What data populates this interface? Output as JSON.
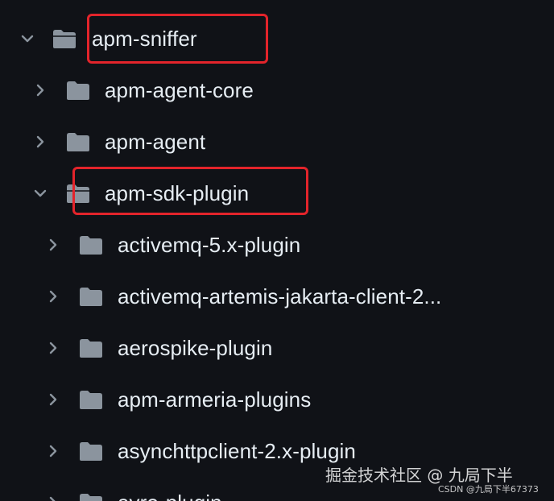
{
  "tree": {
    "items": [
      {
        "label": "apm-sniffer",
        "state": "expanded",
        "depth": 0,
        "highlighted": true
      },
      {
        "label": "apm-agent-core",
        "state": "collapsed",
        "depth": 1,
        "highlighted": false
      },
      {
        "label": "apm-agent",
        "state": "collapsed",
        "depth": 1,
        "highlighted": false
      },
      {
        "label": "apm-sdk-plugin",
        "state": "expanded",
        "depth": 1,
        "highlighted": true
      },
      {
        "label": "activemq-5.x-plugin",
        "state": "collapsed",
        "depth": 2,
        "highlighted": false
      },
      {
        "label": "activemq-artemis-jakarta-client-2...",
        "state": "collapsed",
        "depth": 2,
        "highlighted": false
      },
      {
        "label": "aerospike-plugin",
        "state": "collapsed",
        "depth": 2,
        "highlighted": false
      },
      {
        "label": "apm-armeria-plugins",
        "state": "collapsed",
        "depth": 2,
        "highlighted": false
      },
      {
        "label": "asynchttpclient-2.x-plugin",
        "state": "collapsed",
        "depth": 2,
        "highlighted": false
      },
      {
        "label": "avro-plugin",
        "state": "collapsed",
        "depth": 2,
        "highlighted": false
      }
    ]
  },
  "watermark": {
    "main": "掘金技术社区 @ 九局下半",
    "sub": "CSDN @九局下半67373"
  },
  "colors": {
    "background": "#101217",
    "text": "#e6edf3",
    "folder": "#8b949e",
    "chevron": "#8b949e",
    "highlight": "#e3242b"
  },
  "icons": {
    "collapsed": "chevron-right-icon",
    "expanded": "chevron-down-icon",
    "folder_closed": "folder-icon",
    "folder_open": "folder-open-icon"
  }
}
